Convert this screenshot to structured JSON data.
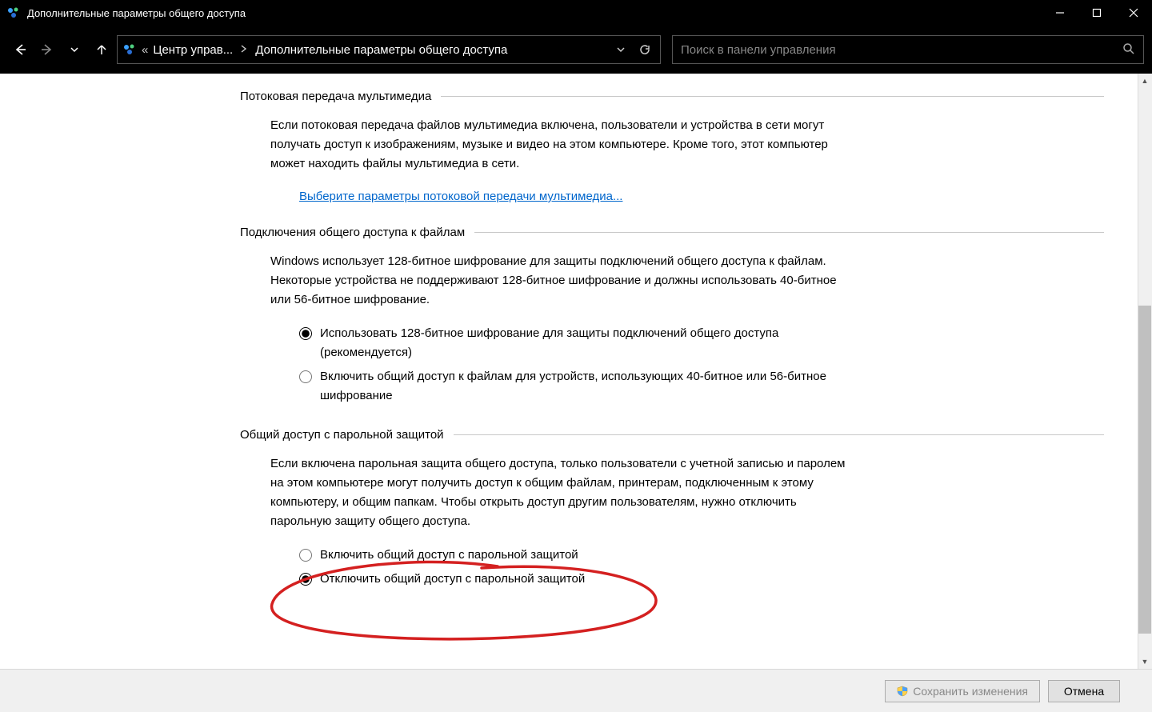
{
  "window": {
    "title": "Дополнительные параметры общего доступа"
  },
  "nav": {
    "breadcrumb_prefix": "«",
    "crumb1": "Центр управ...",
    "crumb2": "Дополнительные параметры общего доступа",
    "search_placeholder": "Поиск в панели управления"
  },
  "sections": {
    "media": {
      "title": "Потоковая передача мультимедиа",
      "para": "Если потоковая передача файлов мультимедиа включена, пользователи и устройства в сети могут получать доступ к изображениям, музыке и видео на этом компьютере. Кроме того, этот компьютер может находить файлы мультимедиа в сети.",
      "link": "Выберите параметры потоковой передачи мультимедиа..."
    },
    "fileconn": {
      "title": "Подключения общего доступа к файлам",
      "para": "Windows использует 128-битное шифрование для защиты подключений общего доступа к файлам. Некоторые устройства не поддерживают 128-битное шифрование и должны использовать 40-битное или 56-битное шифрование.",
      "radio1": "Использовать 128-битное шифрование для защиты подключений общего доступа (рекомендуется)",
      "radio2": "Включить общий доступ к файлам для устройств, использующих 40-битное или 56-битное шифрование"
    },
    "password": {
      "title": "Общий доступ с парольной защитой",
      "para": "Если включена парольная защита общего доступа, только пользователи с учетной записью и паролем на этом компьютере могут получить доступ к общим файлам, принтерам, подключенным к этому компьютеру, и общим папкам. Чтобы открыть доступ другим пользователям, нужно отключить парольную защиту общего доступа.",
      "radio1": "Включить общий доступ с парольной защитой",
      "radio2": "Отключить общий доступ с парольной защитой"
    }
  },
  "footer": {
    "save": "Сохранить изменения",
    "cancel": "Отмена"
  }
}
